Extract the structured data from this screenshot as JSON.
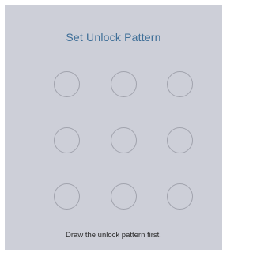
{
  "header": {
    "title": "Set Unlock Pattern"
  },
  "pattern_grid": {
    "rows": 3,
    "columns": 3
  },
  "footer": {
    "hint": "Draw the unlock pattern first."
  },
  "colors": {
    "panel_background": "#cdcfd8",
    "title_color": "#3f6f98",
    "dot_border": "#a1a3ad",
    "hint_color": "#2b2b2b"
  }
}
